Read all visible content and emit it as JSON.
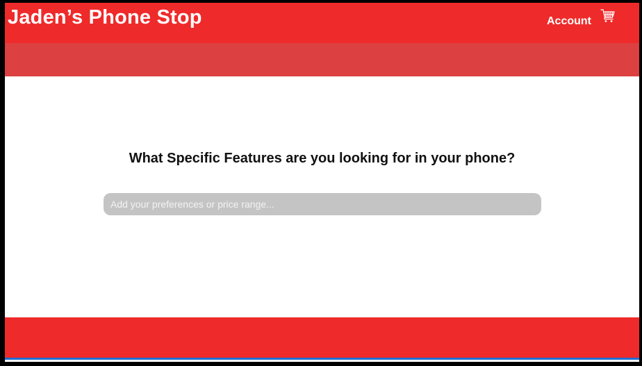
{
  "header": {
    "brand": "Jaden’s Phone Stop",
    "account_label": "Account",
    "cart_icon": "shopping-cart-icon"
  },
  "main": {
    "question": "What Specific Features are you looking for in your phone?",
    "search": {
      "value": "",
      "placeholder": "Add your preferences or price range..."
    }
  },
  "colors": {
    "header_red": "#ef2a2a",
    "subbar_red": "#dc4040",
    "footer_red": "#ef2a2a",
    "input_gray": "#c4c4c4",
    "accent_blue": "#1f6fd1"
  }
}
